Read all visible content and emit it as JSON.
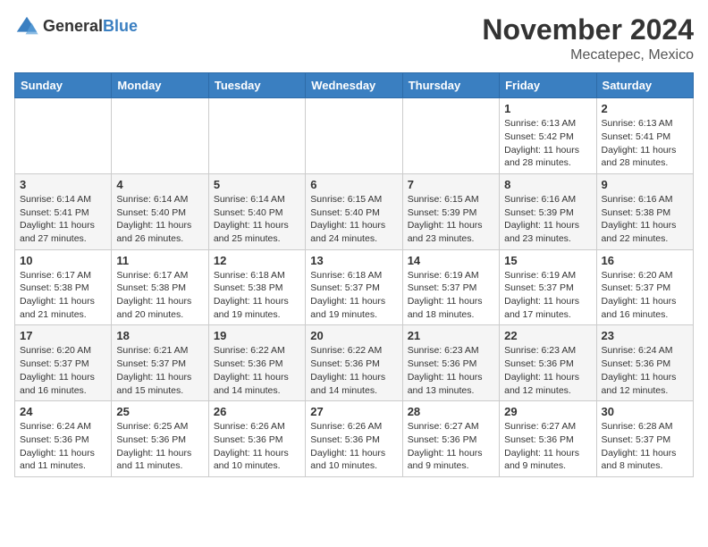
{
  "header": {
    "logo_general": "General",
    "logo_blue": "Blue",
    "month_title": "November 2024",
    "location": "Mecatepec, Mexico"
  },
  "days_of_week": [
    "Sunday",
    "Monday",
    "Tuesday",
    "Wednesday",
    "Thursday",
    "Friday",
    "Saturday"
  ],
  "weeks": [
    [
      {
        "day": "",
        "sunrise": "",
        "sunset": "",
        "daylight": ""
      },
      {
        "day": "",
        "sunrise": "",
        "sunset": "",
        "daylight": ""
      },
      {
        "day": "",
        "sunrise": "",
        "sunset": "",
        "daylight": ""
      },
      {
        "day": "",
        "sunrise": "",
        "sunset": "",
        "daylight": ""
      },
      {
        "day": "",
        "sunrise": "",
        "sunset": "",
        "daylight": ""
      },
      {
        "day": "1",
        "sunrise": "Sunrise: 6:13 AM",
        "sunset": "Sunset: 5:42 PM",
        "daylight": "Daylight: 11 hours and 28 minutes."
      },
      {
        "day": "2",
        "sunrise": "Sunrise: 6:13 AM",
        "sunset": "Sunset: 5:41 PM",
        "daylight": "Daylight: 11 hours and 28 minutes."
      }
    ],
    [
      {
        "day": "3",
        "sunrise": "Sunrise: 6:14 AM",
        "sunset": "Sunset: 5:41 PM",
        "daylight": "Daylight: 11 hours and 27 minutes."
      },
      {
        "day": "4",
        "sunrise": "Sunrise: 6:14 AM",
        "sunset": "Sunset: 5:40 PM",
        "daylight": "Daylight: 11 hours and 26 minutes."
      },
      {
        "day": "5",
        "sunrise": "Sunrise: 6:14 AM",
        "sunset": "Sunset: 5:40 PM",
        "daylight": "Daylight: 11 hours and 25 minutes."
      },
      {
        "day": "6",
        "sunrise": "Sunrise: 6:15 AM",
        "sunset": "Sunset: 5:40 PM",
        "daylight": "Daylight: 11 hours and 24 minutes."
      },
      {
        "day": "7",
        "sunrise": "Sunrise: 6:15 AM",
        "sunset": "Sunset: 5:39 PM",
        "daylight": "Daylight: 11 hours and 23 minutes."
      },
      {
        "day": "8",
        "sunrise": "Sunrise: 6:16 AM",
        "sunset": "Sunset: 5:39 PM",
        "daylight": "Daylight: 11 hours and 23 minutes."
      },
      {
        "day": "9",
        "sunrise": "Sunrise: 6:16 AM",
        "sunset": "Sunset: 5:38 PM",
        "daylight": "Daylight: 11 hours and 22 minutes."
      }
    ],
    [
      {
        "day": "10",
        "sunrise": "Sunrise: 6:17 AM",
        "sunset": "Sunset: 5:38 PM",
        "daylight": "Daylight: 11 hours and 21 minutes."
      },
      {
        "day": "11",
        "sunrise": "Sunrise: 6:17 AM",
        "sunset": "Sunset: 5:38 PM",
        "daylight": "Daylight: 11 hours and 20 minutes."
      },
      {
        "day": "12",
        "sunrise": "Sunrise: 6:18 AM",
        "sunset": "Sunset: 5:38 PM",
        "daylight": "Daylight: 11 hours and 19 minutes."
      },
      {
        "day": "13",
        "sunrise": "Sunrise: 6:18 AM",
        "sunset": "Sunset: 5:37 PM",
        "daylight": "Daylight: 11 hours and 19 minutes."
      },
      {
        "day": "14",
        "sunrise": "Sunrise: 6:19 AM",
        "sunset": "Sunset: 5:37 PM",
        "daylight": "Daylight: 11 hours and 18 minutes."
      },
      {
        "day": "15",
        "sunrise": "Sunrise: 6:19 AM",
        "sunset": "Sunset: 5:37 PM",
        "daylight": "Daylight: 11 hours and 17 minutes."
      },
      {
        "day": "16",
        "sunrise": "Sunrise: 6:20 AM",
        "sunset": "Sunset: 5:37 PM",
        "daylight": "Daylight: 11 hours and 16 minutes."
      }
    ],
    [
      {
        "day": "17",
        "sunrise": "Sunrise: 6:20 AM",
        "sunset": "Sunset: 5:37 PM",
        "daylight": "Daylight: 11 hours and 16 minutes."
      },
      {
        "day": "18",
        "sunrise": "Sunrise: 6:21 AM",
        "sunset": "Sunset: 5:37 PM",
        "daylight": "Daylight: 11 hours and 15 minutes."
      },
      {
        "day": "19",
        "sunrise": "Sunrise: 6:22 AM",
        "sunset": "Sunset: 5:36 PM",
        "daylight": "Daylight: 11 hours and 14 minutes."
      },
      {
        "day": "20",
        "sunrise": "Sunrise: 6:22 AM",
        "sunset": "Sunset: 5:36 PM",
        "daylight": "Daylight: 11 hours and 14 minutes."
      },
      {
        "day": "21",
        "sunrise": "Sunrise: 6:23 AM",
        "sunset": "Sunset: 5:36 PM",
        "daylight": "Daylight: 11 hours and 13 minutes."
      },
      {
        "day": "22",
        "sunrise": "Sunrise: 6:23 AM",
        "sunset": "Sunset: 5:36 PM",
        "daylight": "Daylight: 11 hours and 12 minutes."
      },
      {
        "day": "23",
        "sunrise": "Sunrise: 6:24 AM",
        "sunset": "Sunset: 5:36 PM",
        "daylight": "Daylight: 11 hours and 12 minutes."
      }
    ],
    [
      {
        "day": "24",
        "sunrise": "Sunrise: 6:24 AM",
        "sunset": "Sunset: 5:36 PM",
        "daylight": "Daylight: 11 hours and 11 minutes."
      },
      {
        "day": "25",
        "sunrise": "Sunrise: 6:25 AM",
        "sunset": "Sunset: 5:36 PM",
        "daylight": "Daylight: 11 hours and 11 minutes."
      },
      {
        "day": "26",
        "sunrise": "Sunrise: 6:26 AM",
        "sunset": "Sunset: 5:36 PM",
        "daylight": "Daylight: 11 hours and 10 minutes."
      },
      {
        "day": "27",
        "sunrise": "Sunrise: 6:26 AM",
        "sunset": "Sunset: 5:36 PM",
        "daylight": "Daylight: 11 hours and 10 minutes."
      },
      {
        "day": "28",
        "sunrise": "Sunrise: 6:27 AM",
        "sunset": "Sunset: 5:36 PM",
        "daylight": "Daylight: 11 hours and 9 minutes."
      },
      {
        "day": "29",
        "sunrise": "Sunrise: 6:27 AM",
        "sunset": "Sunset: 5:36 PM",
        "daylight": "Daylight: 11 hours and 9 minutes."
      },
      {
        "day": "30",
        "sunrise": "Sunrise: 6:28 AM",
        "sunset": "Sunset: 5:37 PM",
        "daylight": "Daylight: 11 hours and 8 minutes."
      }
    ]
  ]
}
